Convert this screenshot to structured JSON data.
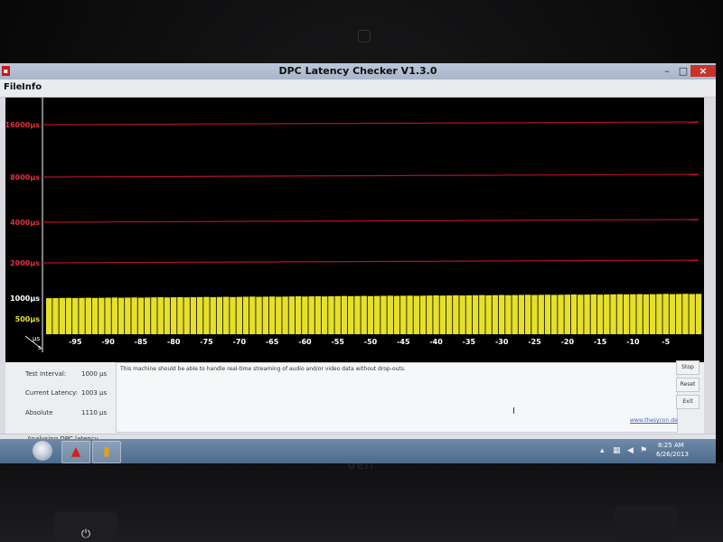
{
  "window": {
    "title": "DPC Latency Checker V1.3.0"
  },
  "menu": {
    "file": "File",
    "info": "Info"
  },
  "chart_data": {
    "type": "bar",
    "title": "",
    "xlabel": "s",
    "ylabel": "µs",
    "y_labels": [
      "16000µs",
      "8000µs",
      "4000µs",
      "2000µs",
      "1000µs",
      "500µs"
    ],
    "x_ticks": [
      -95,
      -90,
      -85,
      -80,
      -75,
      -70,
      -65,
      -60,
      -55,
      -50,
      -45,
      -40,
      -35,
      -30,
      -25,
      -20,
      -15,
      -10,
      -5
    ],
    "xlim": [
      -100,
      0
    ],
    "bar_count": 100,
    "values_start_us": 1000,
    "values_end_us": 1050,
    "bar_color": "#e6e02a",
    "gridline_color": "#b3102a"
  },
  "stats": {
    "test_interval_label": "Test Interval:",
    "test_interval_value": "1000 µs",
    "current_latency_label": "Current Latency:",
    "current_latency_value": "1003 µs",
    "absolute_label": "Absolute",
    "absolute_value": "1110 µs"
  },
  "message": "This machine should be able to handle real-time streaming of audio and/or video data without drop-outs.",
  "link": "www.thesycon.de",
  "buttons": {
    "stop": "Stop",
    "reset": "Reset",
    "exit": "Exit"
  },
  "status": "Analysing DPC latency ...",
  "clock": {
    "time": "8:25 AM",
    "date": "6/26/2013"
  },
  "device": {
    "brand": "dell",
    "power_icon": "⏻"
  }
}
